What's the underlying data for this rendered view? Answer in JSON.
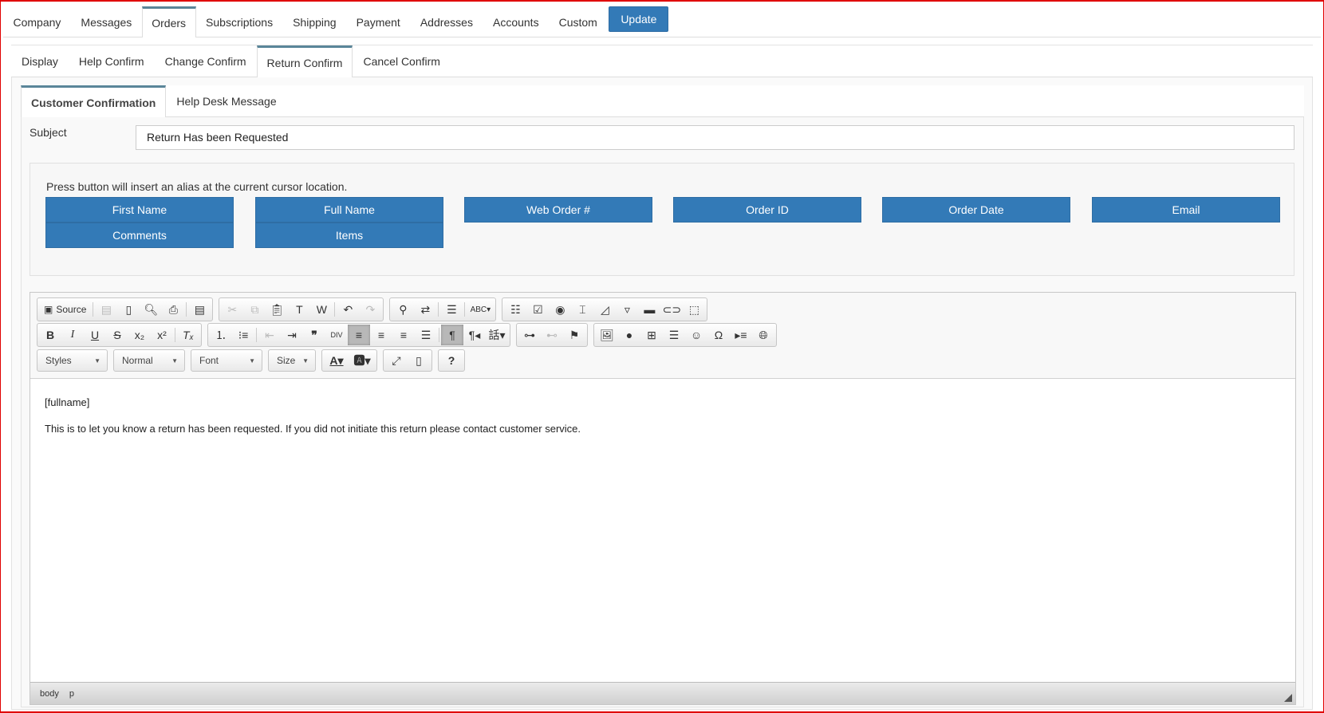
{
  "top_tabs": [
    "Company",
    "Messages",
    "Orders",
    "Subscriptions",
    "Shipping",
    "Payment",
    "Addresses",
    "Accounts",
    "Custom"
  ],
  "update_label": "Update",
  "sub_tabs": [
    "Display",
    "Help Confirm",
    "Change Confirm",
    "Return Confirm",
    "Cancel Confirm"
  ],
  "inner_tabs": [
    "Customer Confirmation",
    "Help Desk Message"
  ],
  "subject": {
    "label": "Subject",
    "value": "Return Has been Requested"
  },
  "alias": {
    "hint": "Press button will insert an alias at the current cursor location.",
    "buttons": [
      "First Name",
      "Full Name",
      "Web Order #",
      "Order ID",
      "Order Date",
      "Email",
      "Comments",
      "Items"
    ]
  },
  "toolbar": {
    "source": "Source",
    "styles": "Styles",
    "format": "Normal",
    "font": "Font",
    "size": "Size"
  },
  "content": {
    "line1": "[fullname]",
    "line2": "This is to let you know a return has been requested. If you did not initiate this return please contact customer service."
  },
  "status": {
    "path": [
      "body",
      "p"
    ]
  },
  "colors": {
    "accent": "#337ab7",
    "tab_border": "#5a8599"
  }
}
